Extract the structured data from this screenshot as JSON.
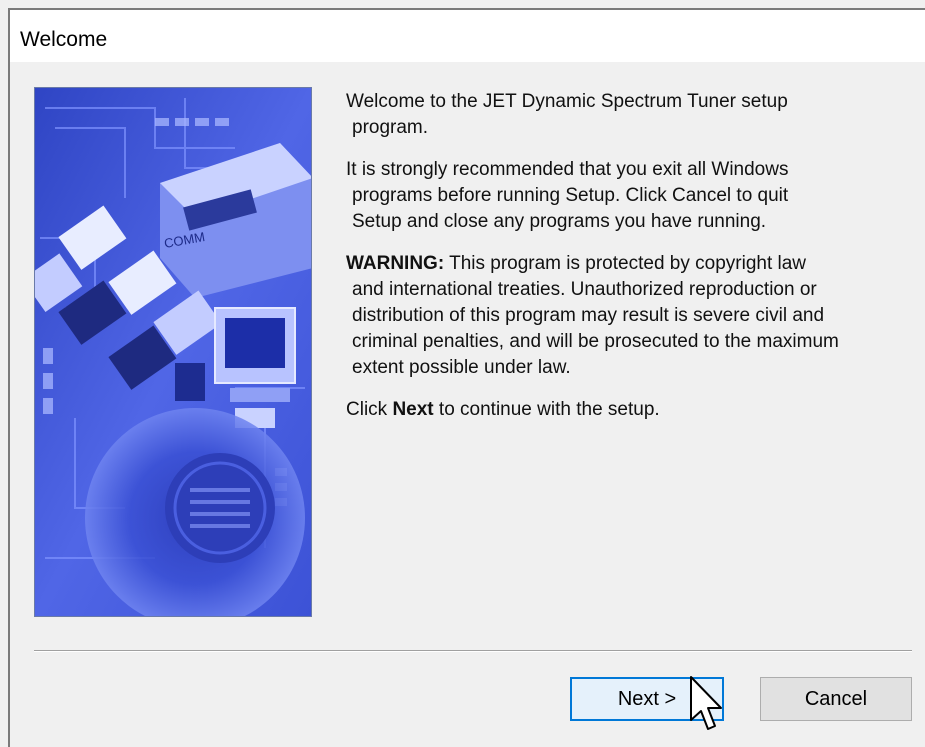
{
  "window": {
    "title": "Welcome"
  },
  "content": {
    "intro_line1": "Welcome to the JET Dynamic Spectrum Tuner setup",
    "intro_line2": "program.",
    "recommend_line1": "It is strongly recommended that you exit all Windows",
    "recommend_line2": "programs before running Setup.  Click Cancel to quit",
    "recommend_line3": "Setup and close any programs you have running.",
    "warning_label": "WARNING:",
    "warning_line1_rest": " This program is protected by copyright law",
    "warning_line2": "and international treaties.  Unauthorized reproduction or",
    "warning_line3": "distribution of this program may result is severe civil and",
    "warning_line4": "criminal penalties, and will be prosecuted to the maximum",
    "warning_line5": "extent possible under law.",
    "click_prefix": "Click ",
    "click_next": "Next",
    "click_suffix": " to continue with the setup."
  },
  "buttons": {
    "next_label": "Next >",
    "cancel_label": "Cancel"
  },
  "banner": {
    "icon": "setup-banner-computer-collage"
  },
  "colors": {
    "banner_blue": "#3f55d8",
    "focus_border": "#0078d7",
    "background": "#f0f0f0"
  }
}
